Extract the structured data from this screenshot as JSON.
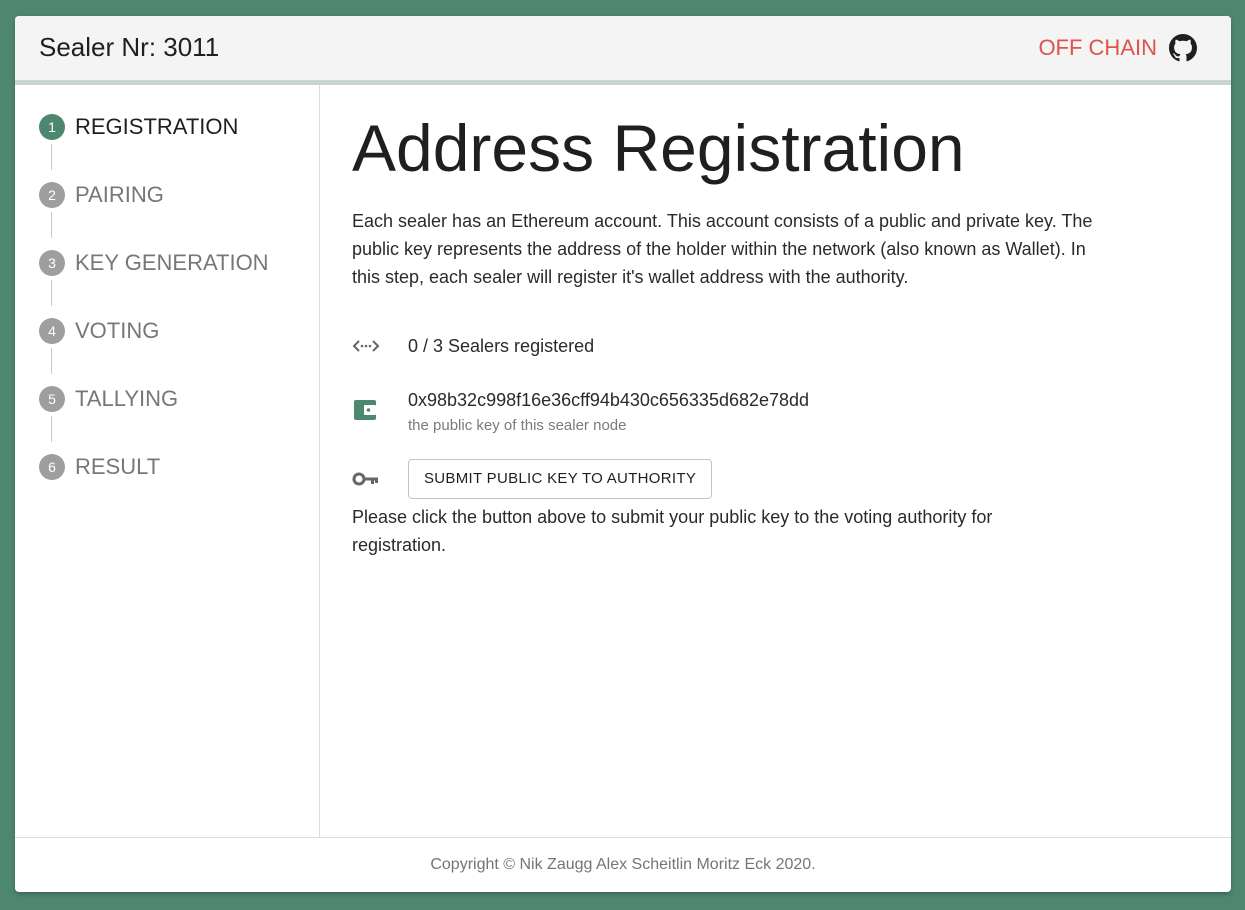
{
  "header": {
    "title": "Sealer Nr: 3011",
    "chain_mode": "OFF CHAIN",
    "chain_mode_color": "#e0524f",
    "github_icon": "github-icon"
  },
  "sidebar": {
    "steps": [
      {
        "number": "1",
        "label": "REGISTRATION",
        "active": true
      },
      {
        "number": "2",
        "label": "PAIRING",
        "active": false
      },
      {
        "number": "3",
        "label": "KEY GENERATION",
        "active": false
      },
      {
        "number": "4",
        "label": "VOTING",
        "active": false
      },
      {
        "number": "5",
        "label": "TALLYING",
        "active": false
      },
      {
        "number": "6",
        "label": "RESULT",
        "active": false
      }
    ]
  },
  "main": {
    "title": "Address Registration",
    "intro": "Each sealer has an Ethereum account. This account consists of a public and private key. The public key represents the address of the holder within the network (also known as Wallet). In this step, each sealer will register it's wallet address with the authority.",
    "registration_status": {
      "icon": "code-brackets-icon",
      "text": "0 / 3 Sealers registered"
    },
    "wallet": {
      "icon": "wallet-icon",
      "address": "0x98b32c998f16e36cff94b430c656335d682e78dd",
      "caption": "the public key of this sealer node"
    },
    "submit": {
      "icon": "key-icon",
      "label": "SUBMIT PUBLIC KEY TO AUTHORITY"
    },
    "note": "Please click the button above to submit your public key to the voting authority for registration."
  },
  "footer": {
    "copyright": "Copyright © Nik Zaugg Alex Scheitlin Moritz Eck 2020."
  },
  "colors": {
    "background": "#4e876f",
    "active_step": "#4e876f",
    "inactive_step": "#9e9e9e",
    "wallet_icon": "#4e876f"
  }
}
